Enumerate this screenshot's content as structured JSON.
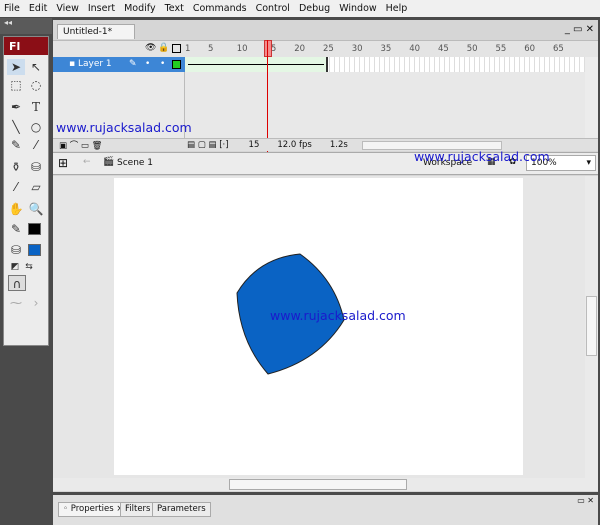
{
  "menu": [
    "File",
    "Edit",
    "View",
    "Insert",
    "Modify",
    "Text",
    "Commands",
    "Control",
    "Debug",
    "Window",
    "Help"
  ],
  "app_logo": "Fl",
  "document_tab": "Untitled-1*",
  "timeline": {
    "frame_numbers": [
      "1",
      "5",
      "10",
      "15",
      "20",
      "25",
      "30",
      "35",
      "40",
      "45",
      "50",
      "55",
      "60",
      "65"
    ],
    "layer_name": "Layer 1",
    "current_frame": "15",
    "fps": "12.0 fps",
    "elapsed": "1.2s"
  },
  "editbar": {
    "scene": "Scene 1",
    "workspace": "Workspace",
    "zoom": "100%"
  },
  "shape_color": "#0a63c4",
  "fill_color": "#0a63c4",
  "stroke_color": "#000000",
  "watermark": "www.rujacksalad.com",
  "panel_tabs": [
    "Properties",
    "Filters",
    "Parameters"
  ]
}
